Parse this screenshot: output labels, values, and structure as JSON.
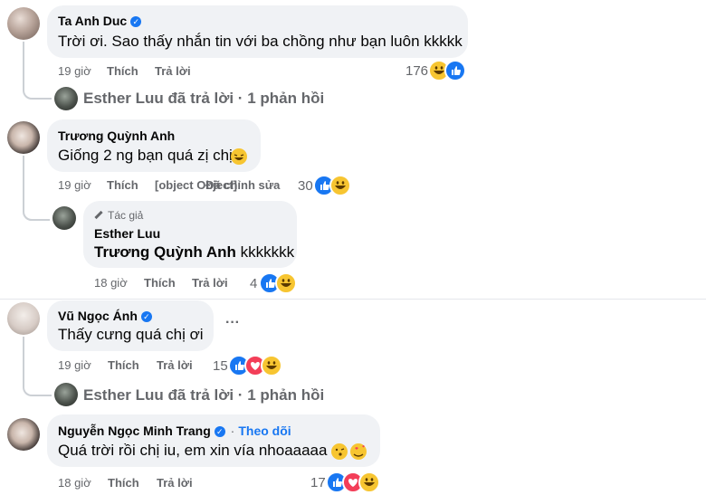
{
  "comments": [
    {
      "author": "Ta Anh Duc",
      "text": "Trời ơi. Sao thấy nhắn tin với ba chồng như bạn luôn kkkkk",
      "time": "19 giờ",
      "like": "Thích",
      "reply": "Trả lời",
      "reaction_count": "176",
      "reactions": [
        "haha",
        "like"
      ],
      "reply_summary_author": "Esther Luu",
      "reply_summary_text": "đã trả lời · 1 phản hồi"
    },
    {
      "author": "Trương Quỳnh Anh",
      "text": "Giống 2 ng bạn quá zị chị",
      "time": "19 giờ",
      "like": "Thích",
      "reply": {
        "badge": "Tác giả",
        "author": "Esther Luu",
        "mention": "Trương Quỳnh Anh",
        "text": "kkkkkkk",
        "time": "18 giờ",
        "like": "Thích",
        "reply": "Trả lời",
        "reaction_count": "4",
        "reactions": [
          "like",
          "haha"
        ]
      },
      "edited": "Đã chỉnh sửa",
      "reaction_count": "30",
      "reactions": [
        "like",
        "haha"
      ]
    },
    {
      "author": "Vũ Ngọc Ánh",
      "text": "Thấy cưng quá chị ơi",
      "more": "···",
      "time": "19 giờ",
      "like": "Thích",
      "reply": "Trả lời",
      "reaction_count": "15",
      "reactions": [
        "like",
        "love",
        "haha"
      ],
      "reply_summary_author": "Esther Luu",
      "reply_summary_text": "đã trả lời · 1 phản hồi"
    },
    {
      "author": "Nguyễn Ngọc Minh Trang",
      "follow": "Theo dõi",
      "text": "Quá trời rồi chị iu, em xin vía nhoaaaaa",
      "time": "18 giờ",
      "like": "Thích",
      "reply": "Trả lời",
      "reaction_count": "17",
      "reactions": [
        "like",
        "love",
        "haha"
      ]
    }
  ],
  "colors": {
    "bubble": "#f0f2f5",
    "meta": "#65676b",
    "link": "#1877f2",
    "like": "#1877f2",
    "love": "#f33e58",
    "haha": "#f7c531"
  }
}
